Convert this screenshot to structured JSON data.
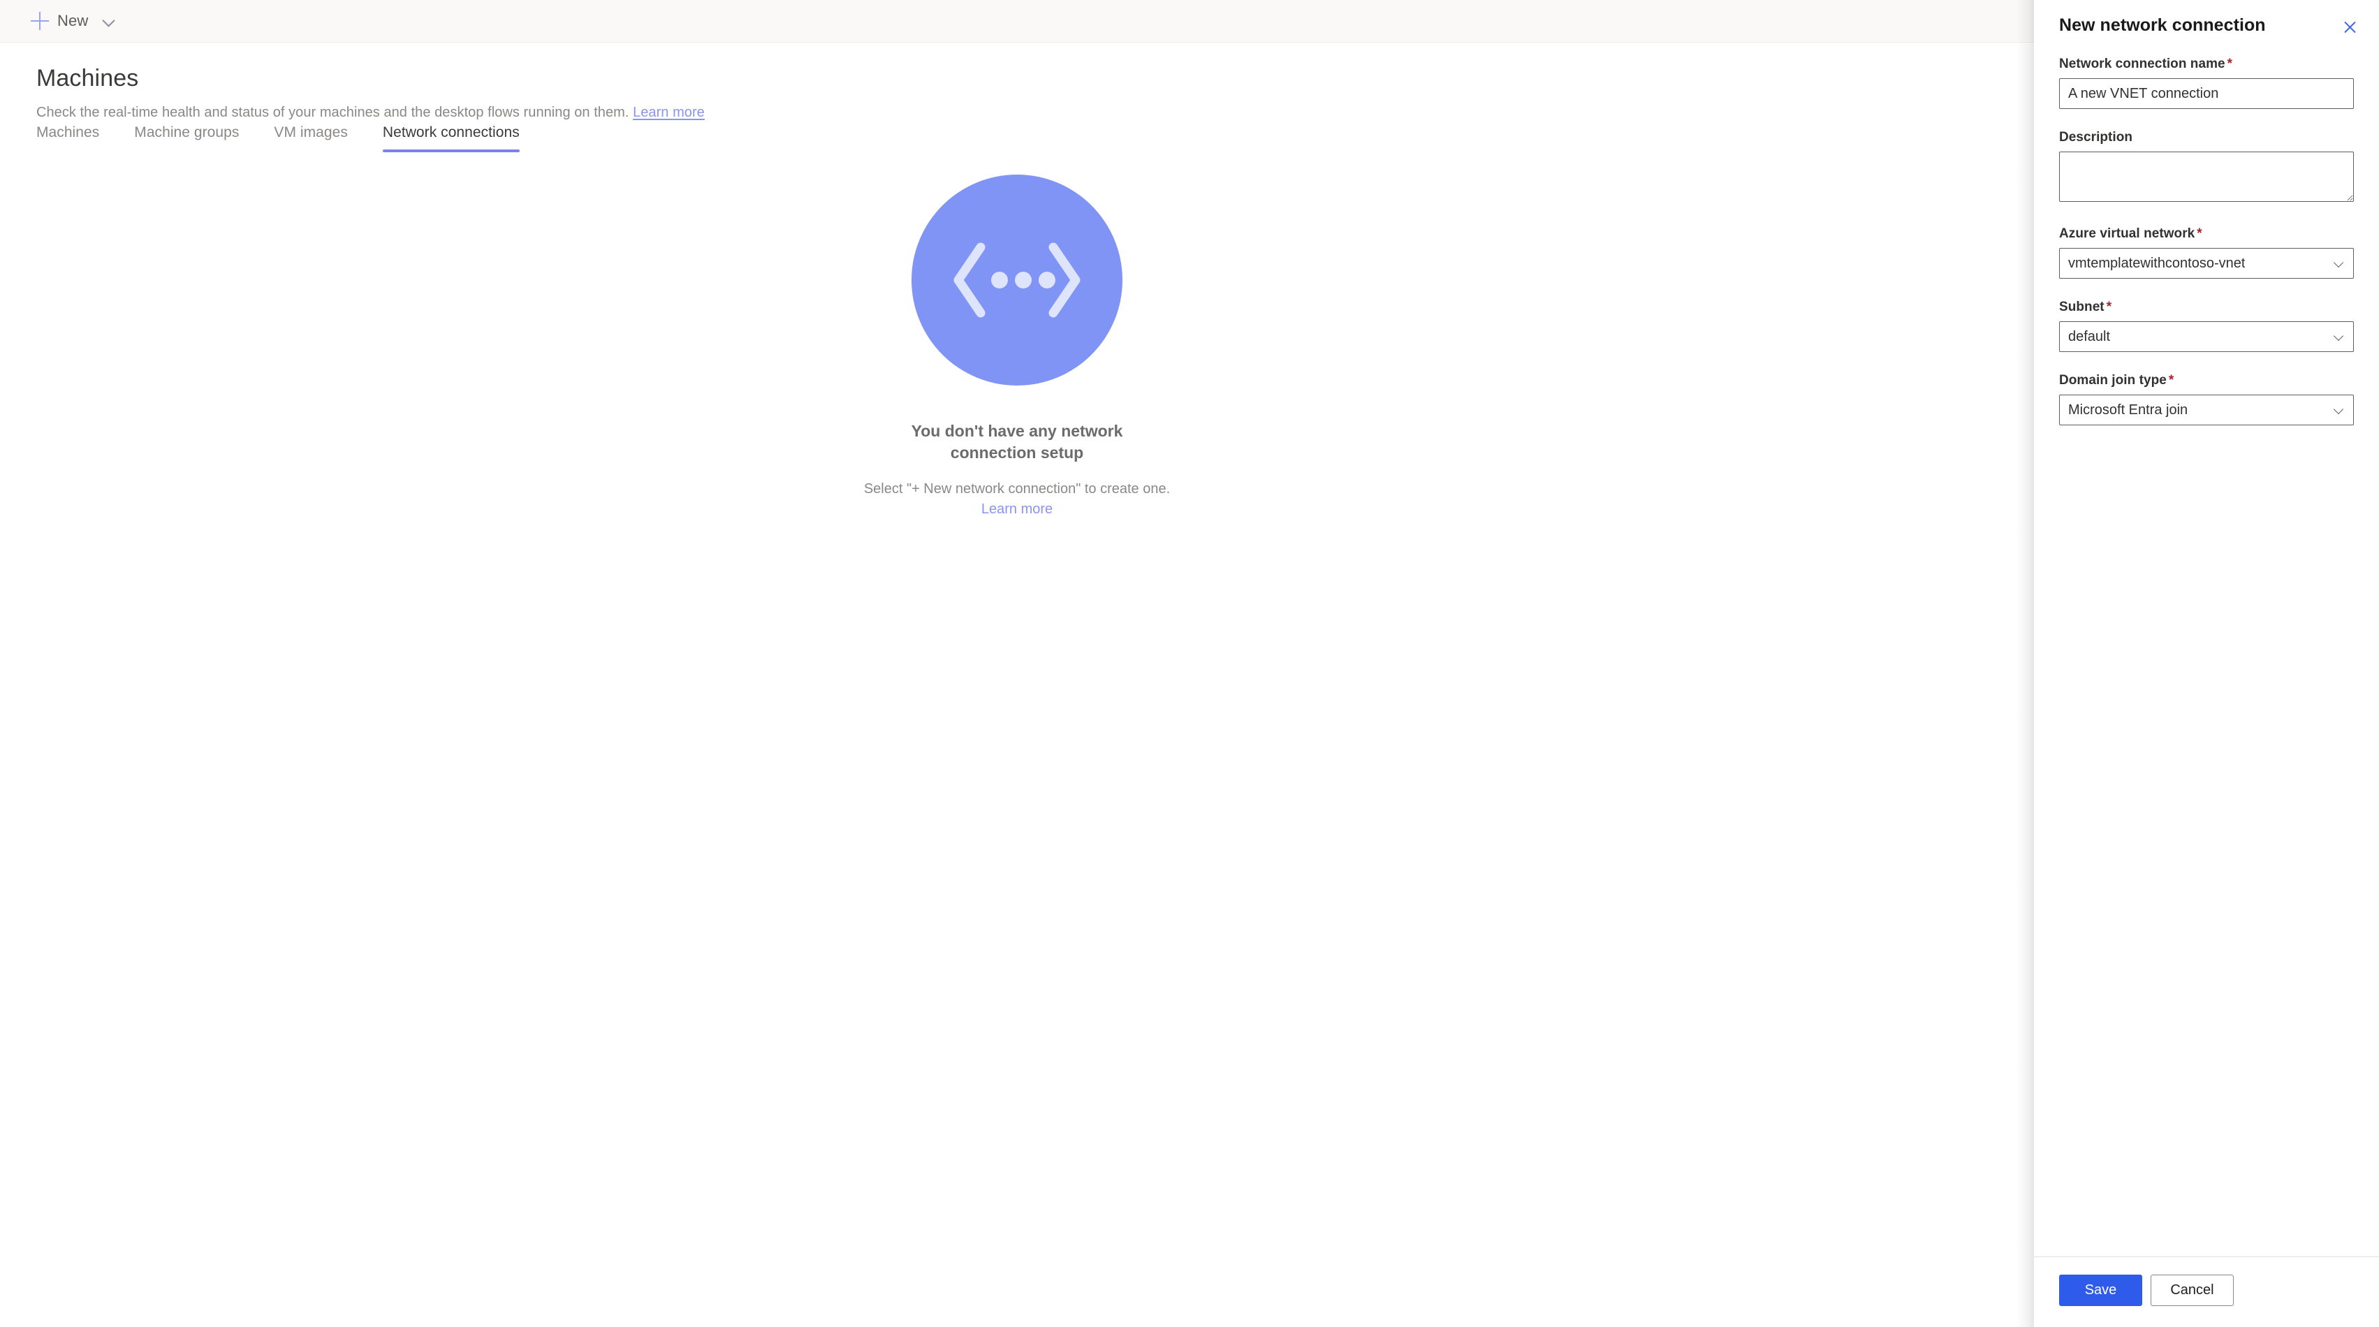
{
  "command_bar": {
    "new_button": {
      "label": "New",
      "plus_icon": "plus-icon",
      "chevron_icon": "chevron-down-icon"
    }
  },
  "page": {
    "title": "Machines",
    "subtitle_text": "Check the real-time health and status of your machines and the desktop flows running on them.",
    "subtitle_link": "Learn more"
  },
  "tabs": [
    {
      "label": "Machines",
      "active": false
    },
    {
      "label": "Machine groups",
      "active": false
    },
    {
      "label": "VM images",
      "active": false
    },
    {
      "label": "Network connections",
      "active": true
    }
  ],
  "empty_state": {
    "illustration_icon": "network-connection-illustration",
    "title": "You don't have any network connection setup",
    "description": "Select \"+ New network connection\" to create one.",
    "link": "Learn more"
  },
  "panel": {
    "title": "New network connection",
    "close_icon": "close-icon",
    "fields": {
      "name": {
        "label": "Network connection name",
        "required": "*",
        "value": "A new VNET connection",
        "placeholder": "A new VNET connection"
      },
      "description": {
        "label": "Description",
        "required": "",
        "value": "",
        "placeholder": ""
      },
      "vnet": {
        "label": "Azure virtual network",
        "required": "*",
        "value": "vmtemplatewithcontoso-vnet",
        "chevron_icon": "chevron-down-icon"
      },
      "subnet": {
        "label": "Subnet",
        "required": "*",
        "value": "default",
        "chevron_icon": "chevron-down-icon"
      },
      "domain_join": {
        "label": "Domain join type",
        "required": "*",
        "value": "Microsoft Entra join",
        "chevron_icon": "chevron-down-icon"
      }
    },
    "footer": {
      "save_label": "Save",
      "cancel_label": "Cancel"
    }
  },
  "colors": {
    "accent_blue": "#2f5bea",
    "link_periwinkle": "#8a94f0",
    "tab_underline": "#7b83eb",
    "illustration_circle": "#8094f5",
    "illustration_glyph": "#dde4fb",
    "required_red": "#a4262c",
    "command_bar_bg": "#faf9f8"
  }
}
